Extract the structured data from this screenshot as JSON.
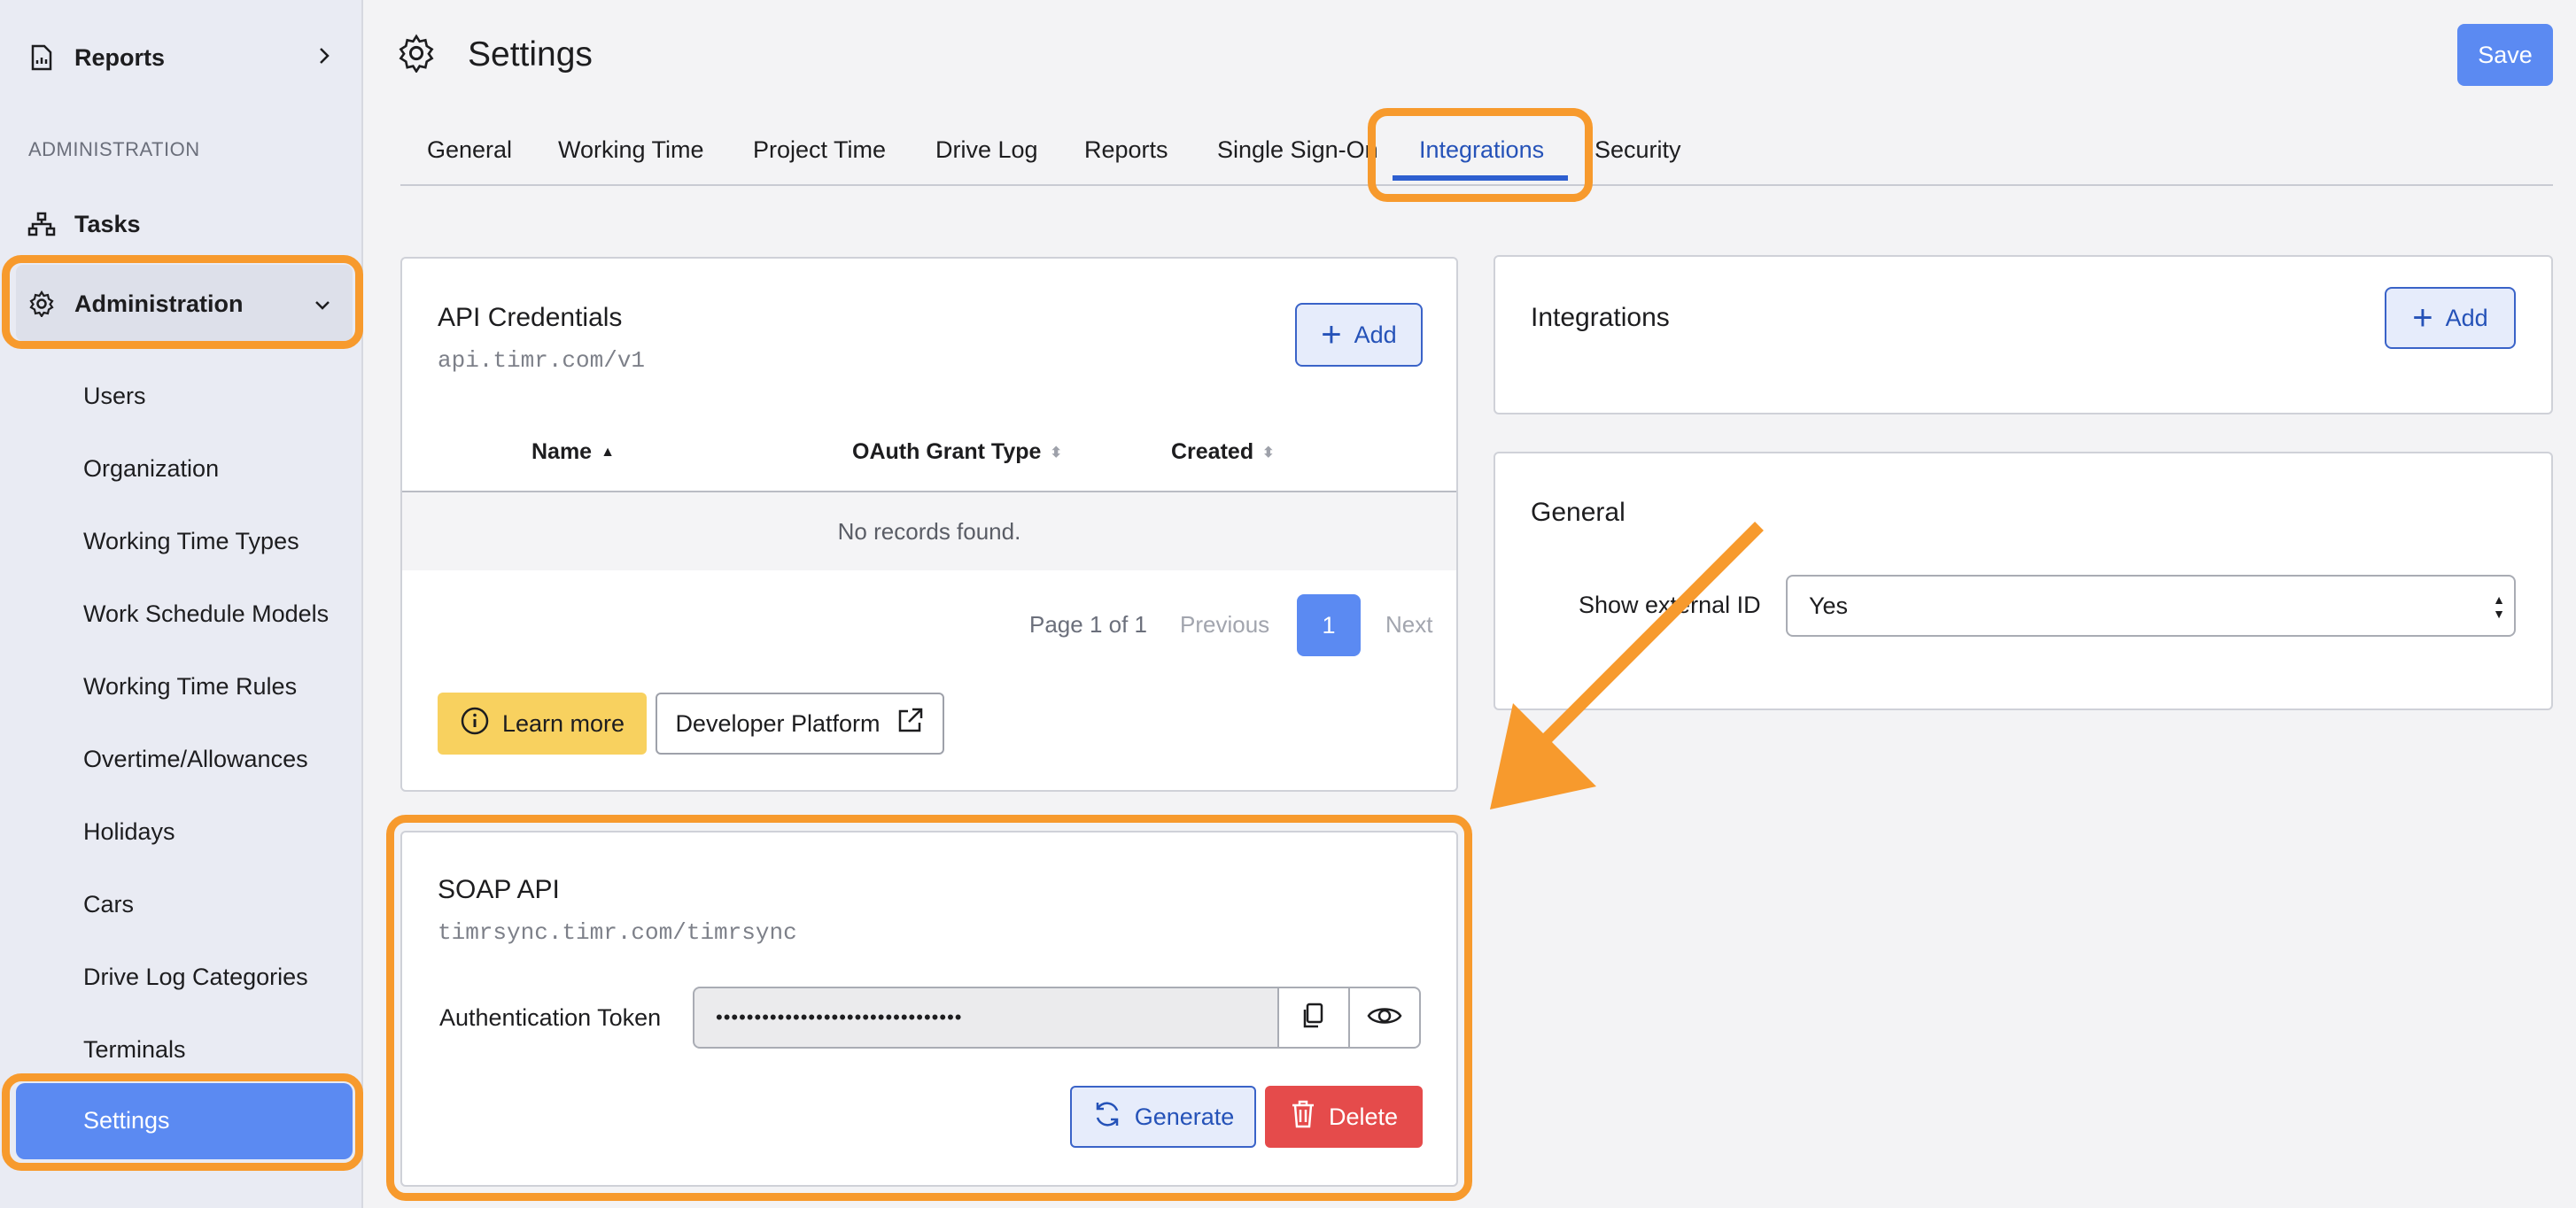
{
  "sidebar": {
    "reports_label": "Reports",
    "section_label": "ADMINISTRATION",
    "tasks_label": "Tasks",
    "administration_label": "Administration",
    "subitems": [
      "Users",
      "Organization",
      "Working Time Types",
      "Work Schedule Models",
      "Working Time Rules",
      "Overtime/Allowances",
      "Holidays",
      "Cars",
      "Drive Log Categories",
      "Terminals"
    ],
    "active_label": "Settings"
  },
  "header": {
    "title": "Settings",
    "save_label": "Save"
  },
  "tabs": [
    "General",
    "Working Time",
    "Project Time",
    "Drive Log",
    "Reports",
    "Single Sign-On",
    "Integrations",
    "Security"
  ],
  "api_credentials": {
    "title": "API Credentials",
    "url": "api.timr.com/v1",
    "add_label": "Add",
    "columns": [
      "Name",
      "OAuth Grant Type",
      "Created"
    ],
    "empty_text": "No records found.",
    "page_info": "Page 1 of 1",
    "previous_label": "Previous",
    "current_page": "1",
    "next_label": "Next",
    "learn_more_label": "Learn more",
    "developer_platform_label": "Developer Platform"
  },
  "integrations": {
    "title": "Integrations",
    "add_label": "Add"
  },
  "general": {
    "title": "General",
    "show_external_id_label": "Show external ID",
    "show_external_id_value": "Yes"
  },
  "soap_api": {
    "title": "SOAP API",
    "url": "timrsync.timr.com/timrsync",
    "token_label": "Authentication Token",
    "token_value": "••••••••••••••••••••••••••••••••",
    "generate_label": "Generate",
    "delete_label": "Delete"
  },
  "colors": {
    "accent": "#5b8af2",
    "highlight": "#f79a2d",
    "danger": "#e54b4b",
    "warning": "#f8d15f"
  }
}
